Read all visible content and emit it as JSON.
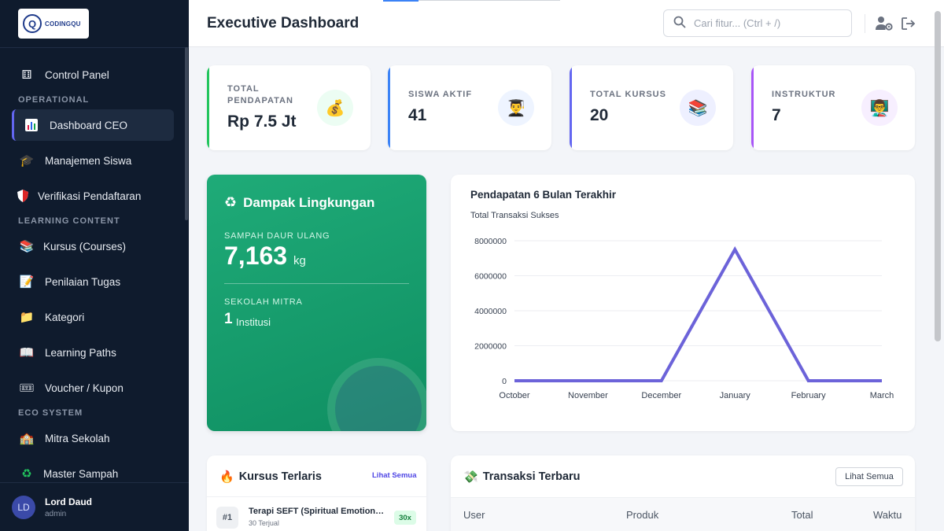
{
  "app": {
    "logo_text": "CODINGQU",
    "logo_glyph": "Q"
  },
  "sidebar": {
    "items": [
      {
        "label": "Control Panel",
        "icon": "dice-icon"
      },
      {
        "label": "Dashboard CEO",
        "icon": "bar-chart-icon"
      },
      {
        "label": "Manajemen Siswa",
        "icon": "graduation-cap-icon"
      },
      {
        "label": "Verifikasi Pendaftaran",
        "icon": "shield-icon"
      },
      {
        "label": "Kursus (Courses)",
        "icon": "books-icon"
      },
      {
        "label": "Penilaian Tugas",
        "icon": "memo-icon"
      },
      {
        "label": "Kategori",
        "icon": "folder-icon"
      },
      {
        "label": "Learning Paths",
        "icon": "open-book-icon"
      },
      {
        "label": "Voucher / Kupon",
        "icon": "ticket-icon"
      },
      {
        "label": "Mitra Sekolah",
        "icon": "school-icon"
      },
      {
        "label": "Master Sampah",
        "icon": "recycle-icon"
      }
    ],
    "sections": [
      "OPERATIONAL",
      "LEARNING CONTENT",
      "ECO SYSTEM"
    ],
    "active_index": 1
  },
  "user": {
    "initials": "LD",
    "name": "Lord Daud",
    "role": "admin"
  },
  "header": {
    "title": "Executive Dashboard",
    "search_placeholder": "Cari fitur... (Ctrl + /)"
  },
  "stats": [
    {
      "label": "TOTAL PENDAPATAN",
      "value": "Rp 7.5 Jt",
      "color": "#22c55e",
      "icon": "money-bag-icon"
    },
    {
      "label": "SISWA AKTIF",
      "value": "41",
      "color": "#3b82f6",
      "icon": "student-icon"
    },
    {
      "label": "TOTAL KURSUS",
      "value": "20",
      "color": "#6366f1",
      "icon": "books-icon"
    },
    {
      "label": "INSTRUKTUR",
      "value": "7",
      "color": "#a855f7",
      "icon": "teacher-icon"
    }
  ],
  "eco": {
    "title": "Dampak Lingkungan",
    "recycled_label": "SAMPAH DAUR ULANG",
    "recycled_value": "7,163",
    "recycled_unit": "kg",
    "partner_label": "SEKOLAH MITRA",
    "partner_value": "1",
    "partner_unit": "Institusi"
  },
  "chart_data": {
    "type": "line",
    "title": "Pendapatan 6 Bulan Terakhir",
    "categories": [
      "October",
      "November",
      "December",
      "January",
      "February",
      "March"
    ],
    "series": [
      {
        "name": "Total Transaksi Sukses",
        "values": [
          0,
          0,
          0,
          7500000,
          0,
          0
        ],
        "color": "#6c63d9"
      }
    ],
    "yticks": [
      0,
      2000000,
      4000000,
      6000000,
      8000000
    ],
    "ylim": [
      0,
      8000000
    ],
    "legend": "top-left"
  },
  "best": {
    "title": "Kursus Terlaris",
    "link": "Lihat Semua",
    "rows": [
      {
        "rank": "#1",
        "name": "Terapi SEFT (Spiritual Emotiona...",
        "sold": "30 Terjual",
        "count": "30x"
      }
    ]
  },
  "transactions": {
    "title": "Transaksi Terbaru",
    "button": "Lihat Semua",
    "columns": [
      "User",
      "Produk",
      "Total",
      "Waktu"
    ]
  }
}
